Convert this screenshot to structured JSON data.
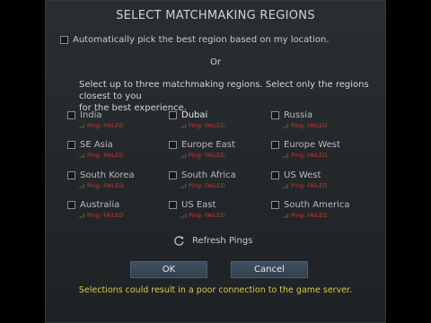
{
  "dialog": {
    "title": "SELECT MATCHMAKING REGIONS",
    "auto_pick_label": "Automatically pick the best region based on my location.",
    "or_label": "Or",
    "instructions_line1": "Select up to three matchmaking regions. Select only the regions closest to you",
    "instructions_line2": "for the best experience.",
    "regions": [
      {
        "name": "India",
        "ping": "Ping: FAILED",
        "selected": false
      },
      {
        "name": "Dubai",
        "ping": "Ping: FAILED",
        "selected": true
      },
      {
        "name": "Russia",
        "ping": "Ping: FAILED",
        "selected": false
      },
      {
        "name": "SE Asia",
        "ping": "Ping: FAILED",
        "selected": false
      },
      {
        "name": "Europe East",
        "ping": "Ping: FAILED",
        "selected": false
      },
      {
        "name": "Europe West",
        "ping": "Ping: FAILED",
        "selected": false
      },
      {
        "name": "South Korea",
        "ping": "Ping: FAILED",
        "selected": false
      },
      {
        "name": "South Africa",
        "ping": "Ping: FAILED",
        "selected": false
      },
      {
        "name": "US West",
        "ping": "Ping: FAILED",
        "selected": false
      },
      {
        "name": "Australia",
        "ping": "Ping: FAILED",
        "selected": false
      },
      {
        "name": "US East",
        "ping": "Ping: FAILED",
        "selected": false
      },
      {
        "name": "South America",
        "ping": "Ping: FAILED",
        "selected": false
      }
    ],
    "refresh_label": "Refresh Pings",
    "ok_label": "OK",
    "cancel_label": "Cancel",
    "warning": "Selections could result in a poor connection to the game server.",
    "colors": {
      "ping_failed": "#c23a2e",
      "warning": "#d9c84a",
      "button": "#3a4858"
    }
  }
}
